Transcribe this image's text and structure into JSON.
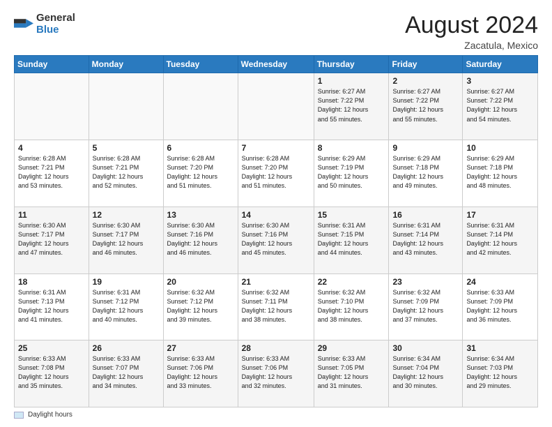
{
  "logo": {
    "general": "General",
    "blue": "Blue"
  },
  "header": {
    "month_year": "August 2024",
    "location": "Zacatula, Mexico"
  },
  "days_of_week": [
    "Sunday",
    "Monday",
    "Tuesday",
    "Wednesday",
    "Thursday",
    "Friday",
    "Saturday"
  ],
  "legend": {
    "label": "Daylight hours"
  },
  "weeks": [
    [
      {
        "day": "",
        "info": ""
      },
      {
        "day": "",
        "info": ""
      },
      {
        "day": "",
        "info": ""
      },
      {
        "day": "",
        "info": ""
      },
      {
        "day": "1",
        "info": "Sunrise: 6:27 AM\nSunset: 7:22 PM\nDaylight: 12 hours\nand 55 minutes."
      },
      {
        "day": "2",
        "info": "Sunrise: 6:27 AM\nSunset: 7:22 PM\nDaylight: 12 hours\nand 55 minutes."
      },
      {
        "day": "3",
        "info": "Sunrise: 6:27 AM\nSunset: 7:22 PM\nDaylight: 12 hours\nand 54 minutes."
      }
    ],
    [
      {
        "day": "4",
        "info": "Sunrise: 6:28 AM\nSunset: 7:21 PM\nDaylight: 12 hours\nand 53 minutes."
      },
      {
        "day": "5",
        "info": "Sunrise: 6:28 AM\nSunset: 7:21 PM\nDaylight: 12 hours\nand 52 minutes."
      },
      {
        "day": "6",
        "info": "Sunrise: 6:28 AM\nSunset: 7:20 PM\nDaylight: 12 hours\nand 51 minutes."
      },
      {
        "day": "7",
        "info": "Sunrise: 6:28 AM\nSunset: 7:20 PM\nDaylight: 12 hours\nand 51 minutes."
      },
      {
        "day": "8",
        "info": "Sunrise: 6:29 AM\nSunset: 7:19 PM\nDaylight: 12 hours\nand 50 minutes."
      },
      {
        "day": "9",
        "info": "Sunrise: 6:29 AM\nSunset: 7:18 PM\nDaylight: 12 hours\nand 49 minutes."
      },
      {
        "day": "10",
        "info": "Sunrise: 6:29 AM\nSunset: 7:18 PM\nDaylight: 12 hours\nand 48 minutes."
      }
    ],
    [
      {
        "day": "11",
        "info": "Sunrise: 6:30 AM\nSunset: 7:17 PM\nDaylight: 12 hours\nand 47 minutes."
      },
      {
        "day": "12",
        "info": "Sunrise: 6:30 AM\nSunset: 7:17 PM\nDaylight: 12 hours\nand 46 minutes."
      },
      {
        "day": "13",
        "info": "Sunrise: 6:30 AM\nSunset: 7:16 PM\nDaylight: 12 hours\nand 46 minutes."
      },
      {
        "day": "14",
        "info": "Sunrise: 6:30 AM\nSunset: 7:16 PM\nDaylight: 12 hours\nand 45 minutes."
      },
      {
        "day": "15",
        "info": "Sunrise: 6:31 AM\nSunset: 7:15 PM\nDaylight: 12 hours\nand 44 minutes."
      },
      {
        "day": "16",
        "info": "Sunrise: 6:31 AM\nSunset: 7:14 PM\nDaylight: 12 hours\nand 43 minutes."
      },
      {
        "day": "17",
        "info": "Sunrise: 6:31 AM\nSunset: 7:14 PM\nDaylight: 12 hours\nand 42 minutes."
      }
    ],
    [
      {
        "day": "18",
        "info": "Sunrise: 6:31 AM\nSunset: 7:13 PM\nDaylight: 12 hours\nand 41 minutes."
      },
      {
        "day": "19",
        "info": "Sunrise: 6:31 AM\nSunset: 7:12 PM\nDaylight: 12 hours\nand 40 minutes."
      },
      {
        "day": "20",
        "info": "Sunrise: 6:32 AM\nSunset: 7:12 PM\nDaylight: 12 hours\nand 39 minutes."
      },
      {
        "day": "21",
        "info": "Sunrise: 6:32 AM\nSunset: 7:11 PM\nDaylight: 12 hours\nand 38 minutes."
      },
      {
        "day": "22",
        "info": "Sunrise: 6:32 AM\nSunset: 7:10 PM\nDaylight: 12 hours\nand 38 minutes."
      },
      {
        "day": "23",
        "info": "Sunrise: 6:32 AM\nSunset: 7:09 PM\nDaylight: 12 hours\nand 37 minutes."
      },
      {
        "day": "24",
        "info": "Sunrise: 6:33 AM\nSunset: 7:09 PM\nDaylight: 12 hours\nand 36 minutes."
      }
    ],
    [
      {
        "day": "25",
        "info": "Sunrise: 6:33 AM\nSunset: 7:08 PM\nDaylight: 12 hours\nand 35 minutes."
      },
      {
        "day": "26",
        "info": "Sunrise: 6:33 AM\nSunset: 7:07 PM\nDaylight: 12 hours\nand 34 minutes."
      },
      {
        "day": "27",
        "info": "Sunrise: 6:33 AM\nSunset: 7:06 PM\nDaylight: 12 hours\nand 33 minutes."
      },
      {
        "day": "28",
        "info": "Sunrise: 6:33 AM\nSunset: 7:06 PM\nDaylight: 12 hours\nand 32 minutes."
      },
      {
        "day": "29",
        "info": "Sunrise: 6:33 AM\nSunset: 7:05 PM\nDaylight: 12 hours\nand 31 minutes."
      },
      {
        "day": "30",
        "info": "Sunrise: 6:34 AM\nSunset: 7:04 PM\nDaylight: 12 hours\nand 30 minutes."
      },
      {
        "day": "31",
        "info": "Sunrise: 6:34 AM\nSunset: 7:03 PM\nDaylight: 12 hours\nand 29 minutes."
      }
    ]
  ]
}
